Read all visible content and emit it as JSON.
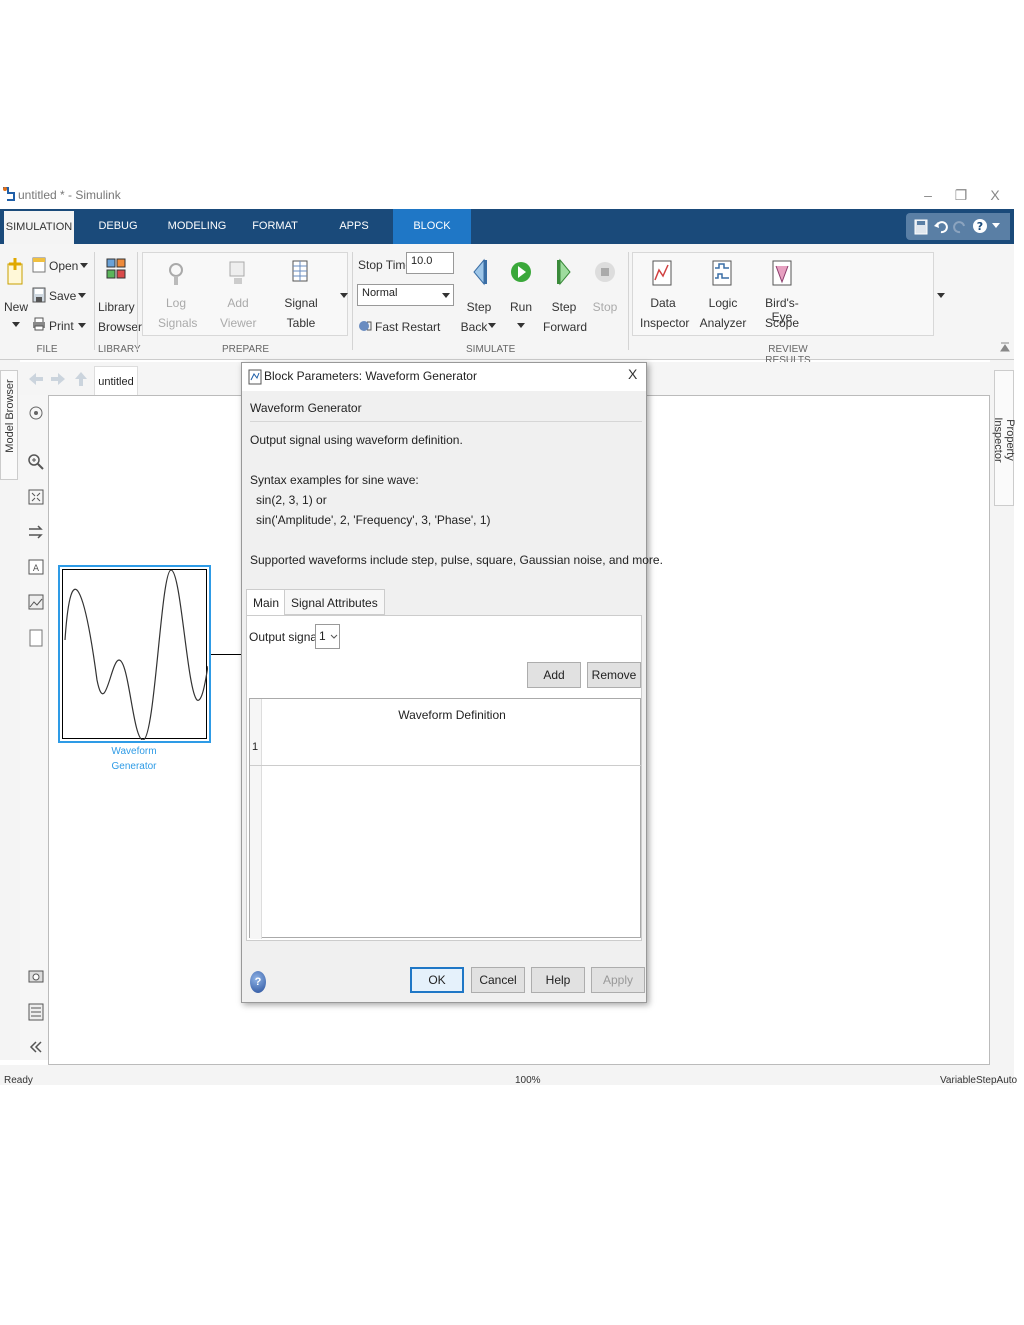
{
  "window": {
    "title": "untitled * - Simulink",
    "minimize": "–",
    "restore": "❐",
    "close": "X"
  },
  "tabs": [
    {
      "label": "SIMULATION"
    },
    {
      "label": "DEBUG"
    },
    {
      "label": "MODELING"
    },
    {
      "label": "FORMAT"
    },
    {
      "label": "APPS"
    },
    {
      "label": "BLOCK"
    }
  ],
  "ribbon": {
    "file": {
      "new": "New",
      "open": "Open",
      "save": "Save",
      "print": "Print",
      "section": "FILE"
    },
    "library": {
      "browser_line1": "Library",
      "browser_line2": "Browser",
      "section": "LIBRARY"
    },
    "prepare": {
      "log_line1": "Log",
      "log_line2": "Signals",
      "add_line1": "Add",
      "add_line2": "Viewer",
      "table_line1": "Signal",
      "table_line2": "Table",
      "section": "PREPARE"
    },
    "simulate": {
      "stop_time_label": "Stop Time",
      "stop_time_value": "10.0",
      "mode_value": "Normal",
      "fast_restart": "Fast Restart",
      "step_back_line1": "Step",
      "step_back_line2": "Back",
      "run": "Run",
      "step_forward_line1": "Step",
      "step_forward_line2": "Forward",
      "stop": "Stop",
      "section": "SIMULATE"
    },
    "review": {
      "data_line1": "Data",
      "data_line2": "Inspector",
      "logic_line1": "Logic",
      "logic_line2": "Analyzer",
      "bird_line1": "Bird's-Eye",
      "bird_line2": "Scope",
      "section": "REVIEW RESULTS"
    }
  },
  "left_panel": {
    "model_browser": "Model Browser"
  },
  "right_panel": {
    "property_inspector": "Property Inspector"
  },
  "breadcrumb": "untitled",
  "block": {
    "name_line1": "Waveform",
    "name_line2": "Generator"
  },
  "status": {
    "left": "Ready",
    "center": "100%",
    "right": "VariableStepAuto"
  },
  "dialog": {
    "title": "Block Parameters: Waveform Generator",
    "close": "X",
    "block_type": "Waveform Generator",
    "description": "Output signal using waveform definition.",
    "syntax_heading": "Syntax examples for sine wave:",
    "syntax_1": "sin(2, 3, 1) or",
    "syntax_2": "sin('Amplitude', 2, 'Frequency', 3, 'Phase', 1)",
    "supported": "Supported waveforms include step, pulse, square, Gaussian noise, and more.",
    "tabs": [
      {
        "label": "Main"
      },
      {
        "label": "Signal Attributes"
      }
    ],
    "output_signal_label": "Output signal:",
    "output_signal_value": "1",
    "add": "Add",
    "remove": "Remove",
    "table_header": "Waveform Definition",
    "row_number": "1",
    "ok": "OK",
    "cancel": "Cancel",
    "help": "Help",
    "apply": "Apply"
  }
}
